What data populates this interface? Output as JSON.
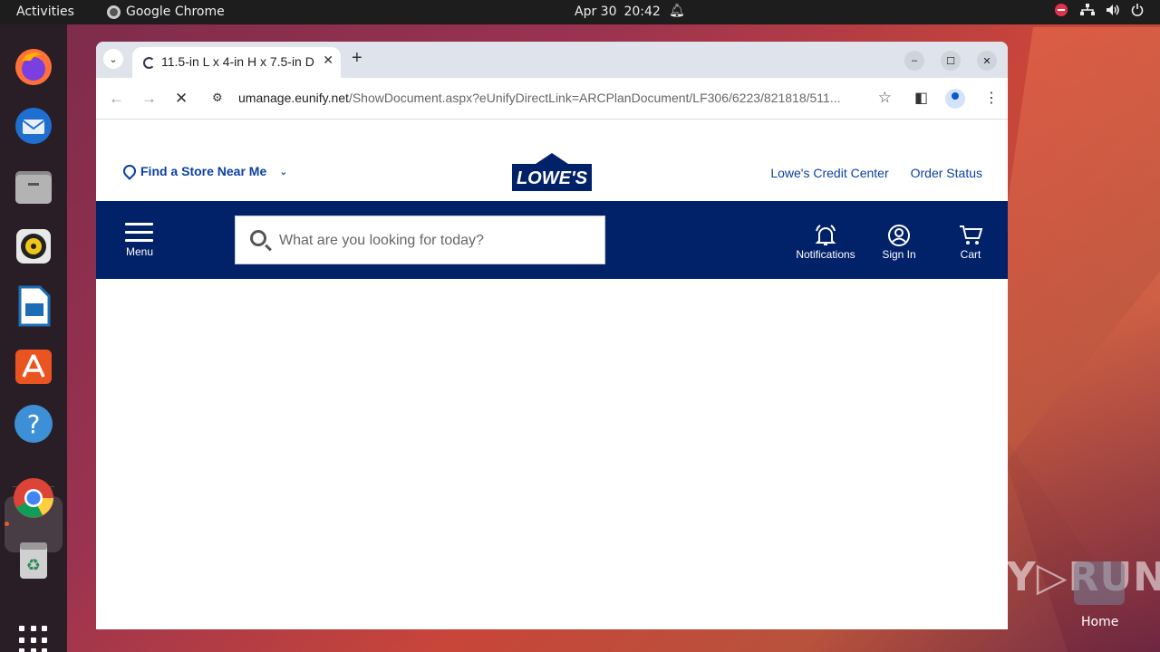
{
  "topbar": {
    "activities": "Activities",
    "app_name": "Google Chrome",
    "date": "Apr 30",
    "time": "20:42"
  },
  "dock": {
    "items": [
      "firefox-icon",
      "thunderbird-icon",
      "files-icon",
      "rhythmbox-icon",
      "writer-icon",
      "app-center-icon",
      "help-icon",
      "chrome-icon",
      "trash-icon",
      "show-apps-icon"
    ]
  },
  "browser": {
    "tab_title": "11.5-in L x 4-in H x 7.5-in D",
    "url_domain": "umanage.eunify.net",
    "url_path": "/ShowDocument.aspx?eUnifyDirectLink=ARCPlanDocument/LF306/6223/821818/511..."
  },
  "page": {
    "store_link": "Find a Store Near Me",
    "logo_text": "LOWE'S",
    "credit_center": "Lowe's Credit Center",
    "order_status": "Order Status",
    "menu_label": "Menu",
    "search_placeholder": "What are you looking for today?",
    "notifications_label": "Notifications",
    "sign_in_label": "Sign In",
    "cart_label": "Cart",
    "brand_color": "#012169",
    "link_color": "#0a3fa6"
  },
  "desktop": {
    "watermark": "ANY▷RUN",
    "home_label": "Home"
  }
}
